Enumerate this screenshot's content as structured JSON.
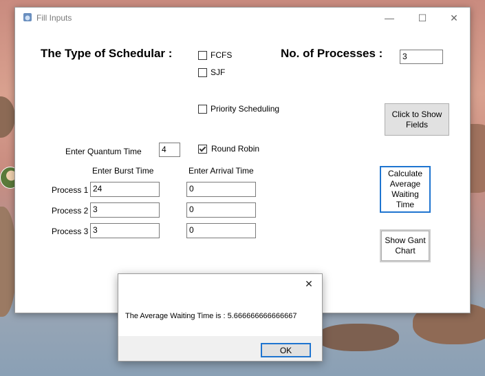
{
  "window": {
    "title": "Fill Inputs",
    "controls": {
      "minimize": "—",
      "maximize": "☐",
      "close": "✕"
    }
  },
  "scheduler": {
    "heading": "The Type of Schedular :",
    "options": [
      {
        "label": "FCFS",
        "checked": false
      },
      {
        "label": "SJF",
        "checked": false
      },
      {
        "label": "Priority Scheduling",
        "checked": false
      },
      {
        "label": "Round Robin",
        "checked": true
      }
    ]
  },
  "processes": {
    "heading": "No. of Processes :",
    "count": "3",
    "show_fields_button": "Click to Show Fields"
  },
  "quantum": {
    "label": "Enter Quantum Time",
    "value": "4"
  },
  "table": {
    "burst_header": "Enter Burst Time",
    "arrival_header": "Enter Arrival Time",
    "rows": [
      {
        "label": "Process 1",
        "burst": "24",
        "arrival": "0"
      },
      {
        "label": "Process 2",
        "burst": "3",
        "arrival": "0"
      },
      {
        "label": "Process 3",
        "burst": "3",
        "arrival": "0"
      }
    ]
  },
  "buttons": {
    "calculate": "Calculate Average Waiting Time",
    "gantt": "Show Gant Chart"
  },
  "dialog": {
    "message": "The Average Waiting Time is : 5.666666666666667",
    "ok": "OK",
    "close": "✕"
  }
}
